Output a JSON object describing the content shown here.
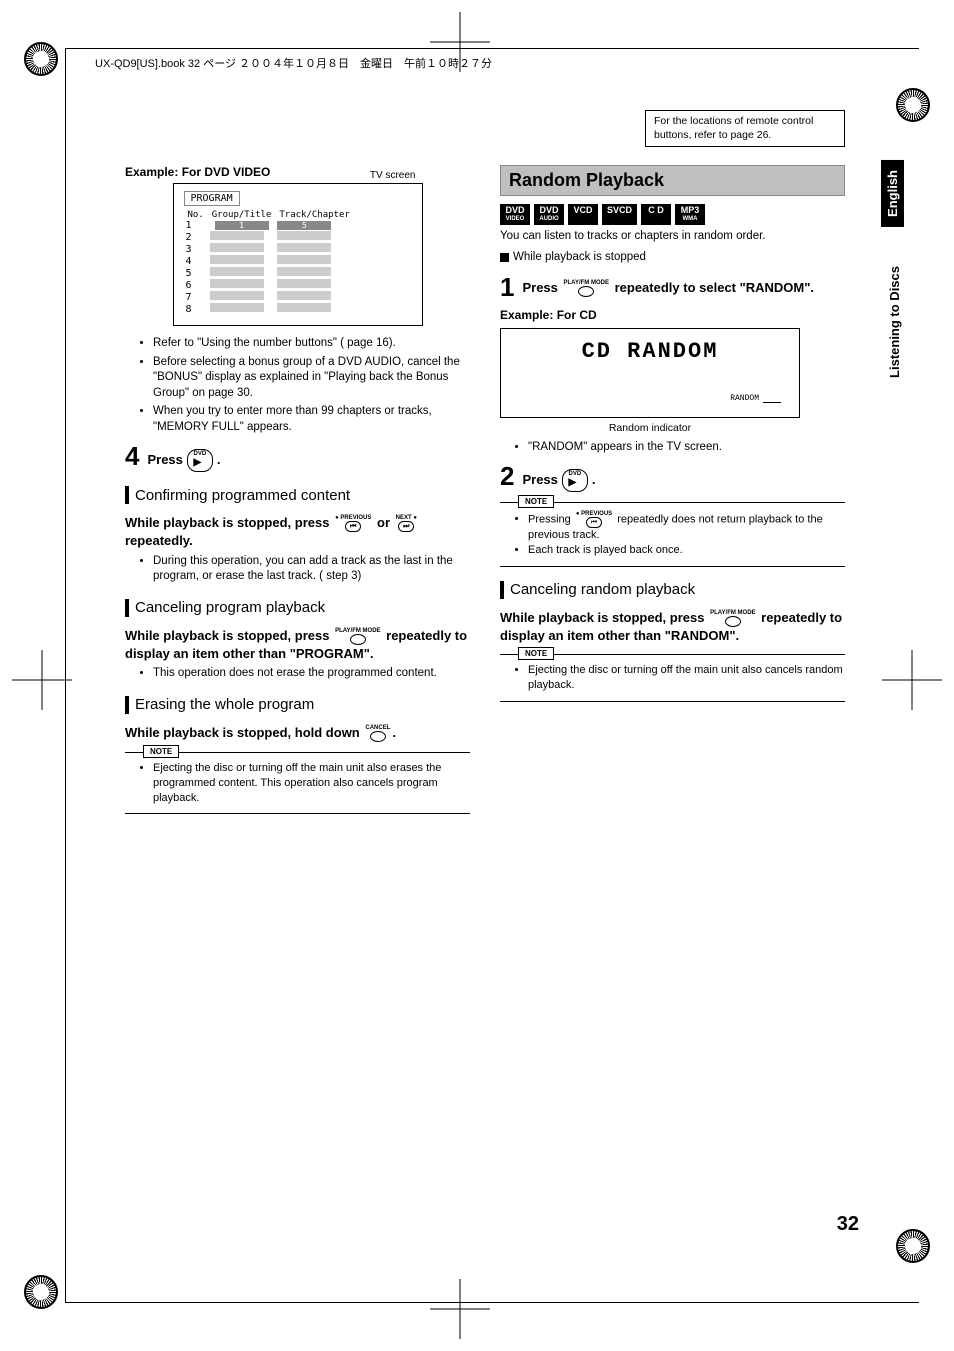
{
  "header_line": "UX-QD9[US].book  32 ページ  ２００４年１０月８日　金曜日　午前１０時２７分",
  "ref_box": "For the locations of remote control buttons, refer to page 26.",
  "side": {
    "lang": "English",
    "section": "Listening to Discs"
  },
  "page_number": "32",
  "left": {
    "example_title": "Example: For DVD VIDEO",
    "tv_label": "TV screen",
    "program_label": "PROGRAM",
    "th_no": "No.",
    "th_gt": "Group/Title",
    "th_tc": "Track/Chapter",
    "rows": [
      "1",
      "2",
      "3",
      "4",
      "5",
      "6",
      "7",
      "8"
    ],
    "row1_gt": "1",
    "row1_tc": "5",
    "bul1": "Refer to \"Using the number buttons\" (        page 16).",
    "bul2": "Before selecting a bonus group of a DVD AUDIO, cancel the \"BONUS\" display as explained in \"Playing back the Bonus Group\" on page 30.",
    "bul3": "When you try to enter more than 99 chapters or tracks, \"MEMORY FULL\" appears.",
    "step4_num": "4",
    "step4_text_a": "Press ",
    "step4_text_b": ".",
    "confirm_h": "Confirming programmed content",
    "confirm_bold_a": "While playback is stopped, press ",
    "confirm_bold_b": " or ",
    "confirm_bold_c": " repeatedly.",
    "confirm_bullet": "During this operation, you can add a track as the last in the program, or erase the last track. (        step 3)",
    "cancel_h": "Canceling program playback",
    "cancel_bold": "While playback is stopped, press        repeatedly to display an item other than \"PROGRAM\".",
    "cancel_bullet": "This operation does not erase the programmed content.",
    "erase_h": "Erasing the whole program",
    "erase_bold": "While playback is stopped, hold down       .",
    "note_label": "NOTE",
    "erase_note": "Ejecting the disc or turning off the main unit also erases the programmed content. This operation also cancels program playback."
  },
  "right": {
    "title": "Random Playback",
    "badges": [
      {
        "l1": "DVD",
        "l2": "VIDEO"
      },
      {
        "l1": "DVD",
        "l2": "AUDIO"
      },
      {
        "l1": "VCD",
        "l2": ""
      },
      {
        "l1": "SVCD",
        "l2": ""
      },
      {
        "l1": "C D",
        "l2": ""
      },
      {
        "l1": "MP3",
        "l2": "WMA"
      }
    ],
    "intro": "You can listen to tracks or chapters in random order.",
    "precond": "While playback is stopped",
    "step1_num": "1",
    "step1_a": "Press ",
    "step1_b": " repeatedly to select \"RANDOM\".",
    "example_title": "Example: For CD",
    "lcd_text": "CD RANDOM",
    "lcd_tag": "RANDOM",
    "rand_indicator": "Random indicator",
    "bullet_tv": "\"RANDOM\" appears in the TV screen.",
    "step2_num": "2",
    "step2_a": "Press ",
    "step2_b": ".",
    "note_label": "NOTE",
    "note1a": "Pressing ",
    "note1b": " repeatedly does not return playback to the previous track.",
    "note2": "Each track is played back once.",
    "cancel_h": "Canceling random playback",
    "cancel_bold": "While playback is stopped, press        repeatedly to display an item other than \"RANDOM\".",
    "cancel_note": "Ejecting the disc or turning off the main unit also cancels random playback."
  },
  "icons": {
    "dvd_play": "DVD",
    "prev": "PREVIOUS",
    "next": "NEXT",
    "playmode": "PLAY/FM MODE",
    "cancel": "CANCEL"
  }
}
